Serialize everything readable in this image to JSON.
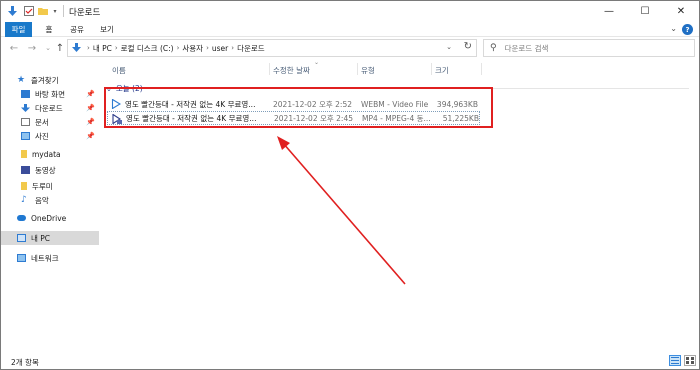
{
  "window": {
    "title": "다운로드",
    "controls": {
      "minimize": "—",
      "maximize": "☐",
      "close": "✕"
    }
  },
  "ribbon": {
    "tabs": [
      "파일",
      "홈",
      "공유",
      "보기"
    ],
    "help": "?"
  },
  "address_bar": {
    "crumbs": [
      "내 PC",
      "로컬 디스크 (C:)",
      "사용자",
      "user",
      "다운로드"
    ]
  },
  "search": {
    "placeholder": "다운로드 검색"
  },
  "nav_pane": {
    "quick_access": "즐겨찾기",
    "items": [
      {
        "label": "바탕 화면",
        "pinned": true,
        "icon": "desktop-icon"
      },
      {
        "label": "다운로드",
        "pinned": true,
        "icon": "download-icon"
      },
      {
        "label": "문서",
        "pinned": true,
        "icon": "document-icon"
      },
      {
        "label": "사진",
        "pinned": true,
        "icon": "pictures-icon"
      },
      {
        "label": "mydata",
        "pinned": false,
        "icon": "folder-icon"
      },
      {
        "label": "동영상",
        "pinned": false,
        "icon": "videos-icon"
      },
      {
        "label": "두루미",
        "pinned": false,
        "icon": "folder-icon"
      },
      {
        "label": "음악",
        "pinned": false,
        "icon": "music-icon"
      }
    ],
    "onedrive": "OneDrive",
    "this_pc": "내 PC",
    "network": "네트워크"
  },
  "columns": {
    "name": "이름",
    "date": "수정한 날짜",
    "type": "유형",
    "size": "크기"
  },
  "group": {
    "label": "오늘 (2)"
  },
  "files": [
    {
      "name": "영도 빨간등대 - 저작권 없는 4K 무료영...",
      "date": "2021-12-02 오후 2:52",
      "type": "WEBM - Video File",
      "size": "394,963KB"
    },
    {
      "name": "영도 빨간등대 - 저작권 없는 4K 무료영...",
      "date": "2021-12-02 오후 2:45",
      "type": "MP4 - MPEG-4 동...",
      "size": "51,225KB"
    }
  ],
  "status": {
    "item_count": "2개 항목"
  },
  "colors": {
    "accent": "#1979ca",
    "annotation": "#e02020"
  }
}
